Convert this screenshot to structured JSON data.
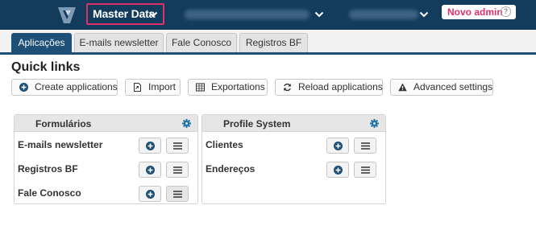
{
  "header": {
    "title": "Master Data",
    "new_admin_label": "Novo admin",
    "help_glyph": "?",
    "colors": {
      "bar": "#133b5c",
      "highlight": "#e0306a"
    }
  },
  "tabs": [
    {
      "label": "Aplicações",
      "active": true
    },
    {
      "label": "E-mails newsletter",
      "active": false
    },
    {
      "label": "Fale Conosco",
      "active": false
    },
    {
      "label": "Registros BF",
      "active": false
    }
  ],
  "quick_links": {
    "title": "Quick links",
    "buttons": [
      {
        "label": "Create applications",
        "icon": "plus-circle-icon"
      },
      {
        "label": "Import",
        "icon": "file-import-icon"
      },
      {
        "label": "Exportations",
        "icon": "table-icon"
      },
      {
        "label": "Reload applications",
        "icon": "refresh-icon"
      },
      {
        "label": "Advanced settings",
        "icon": "warning-icon"
      }
    ]
  },
  "panels": [
    {
      "title": "Formulários",
      "rows": [
        "E-mails newsletter",
        "Registros BF",
        "Fale Conosco"
      ]
    },
    {
      "title": "Profile System",
      "rows": [
        "Clientes",
        "Endereços"
      ]
    }
  ]
}
